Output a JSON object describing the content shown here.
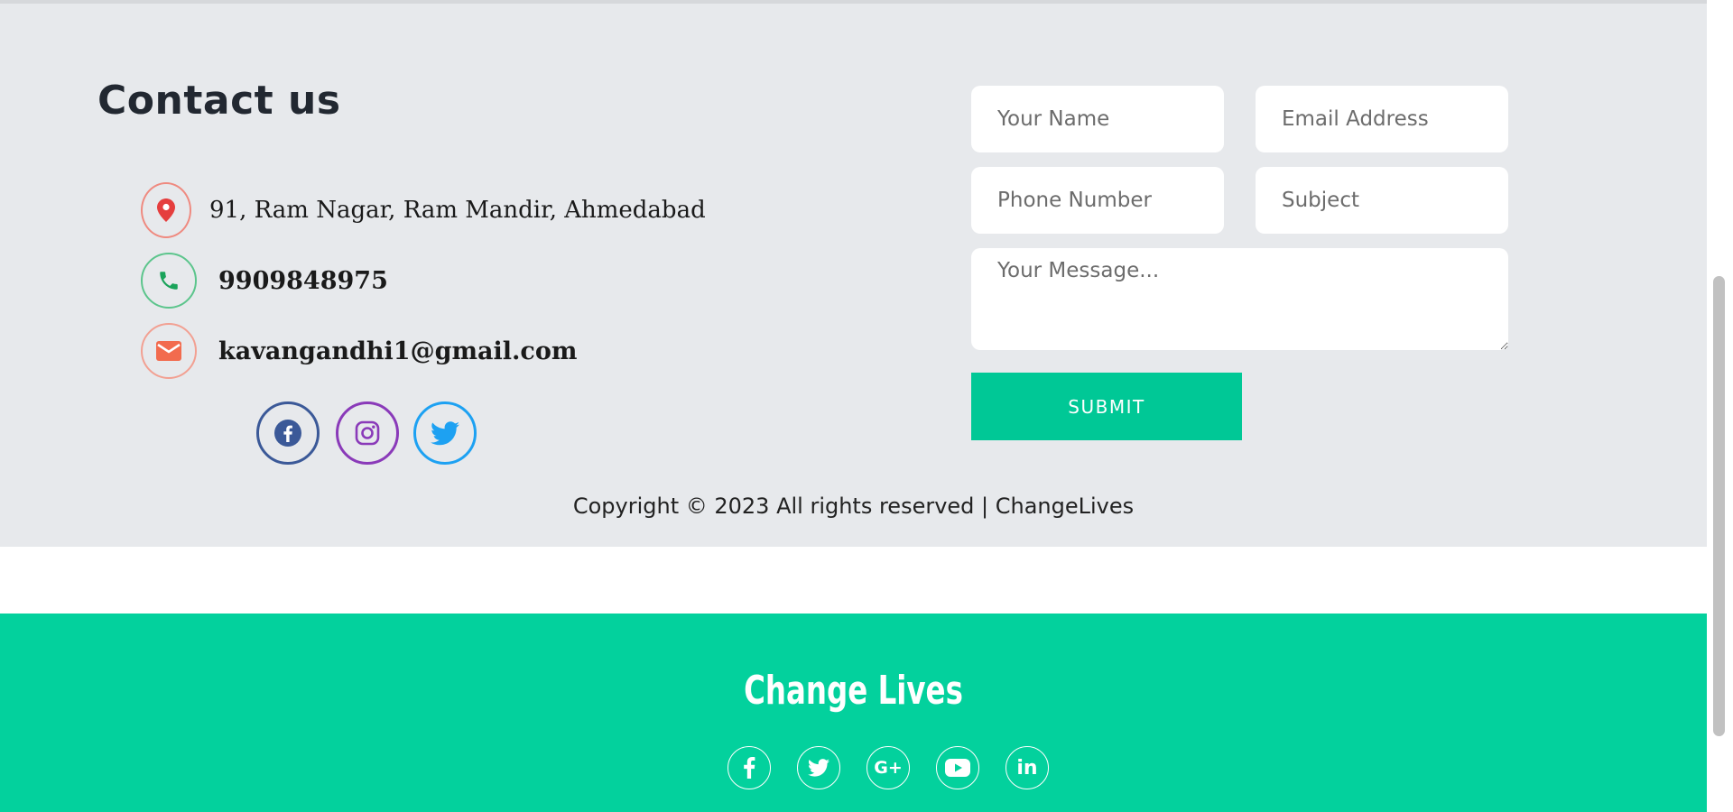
{
  "contact": {
    "heading": "Contact us",
    "address": "91, Ram Nagar, Ram Mandir, Ahmedabad",
    "phone": "9909848975",
    "email": "kavangandhi1@gmail.com",
    "icons": {
      "address": "map-pin-icon",
      "phone": "phone-icon",
      "email": "envelope-icon"
    },
    "socials": [
      {
        "name": "facebook-icon",
        "color": "#3b5998"
      },
      {
        "name": "instagram-icon",
        "color": "#8a3ab9"
      },
      {
        "name": "twitter-icon",
        "color": "#1da1f2"
      }
    ]
  },
  "form": {
    "name_placeholder": "Your Name",
    "email_placeholder": "Email Address",
    "phone_placeholder": "Phone Number",
    "subject_placeholder": "Subject",
    "message_placeholder": "Your Message...",
    "submit_label": "SUBMIT"
  },
  "copyright": "Copyright © 2023 All rights reserved | ChangeLives",
  "footer": {
    "brand": "Change Lives",
    "socials": [
      "facebook-icon",
      "twitter-icon",
      "google-plus-icon",
      "youtube-icon",
      "linkedin-icon"
    ],
    "google_plus_glyph": "G+",
    "linkedin_glyph": "in"
  },
  "colors": {
    "accent": "#00c896",
    "footer_bg": "#03d19d",
    "section_bg": "#e7e9ec"
  }
}
